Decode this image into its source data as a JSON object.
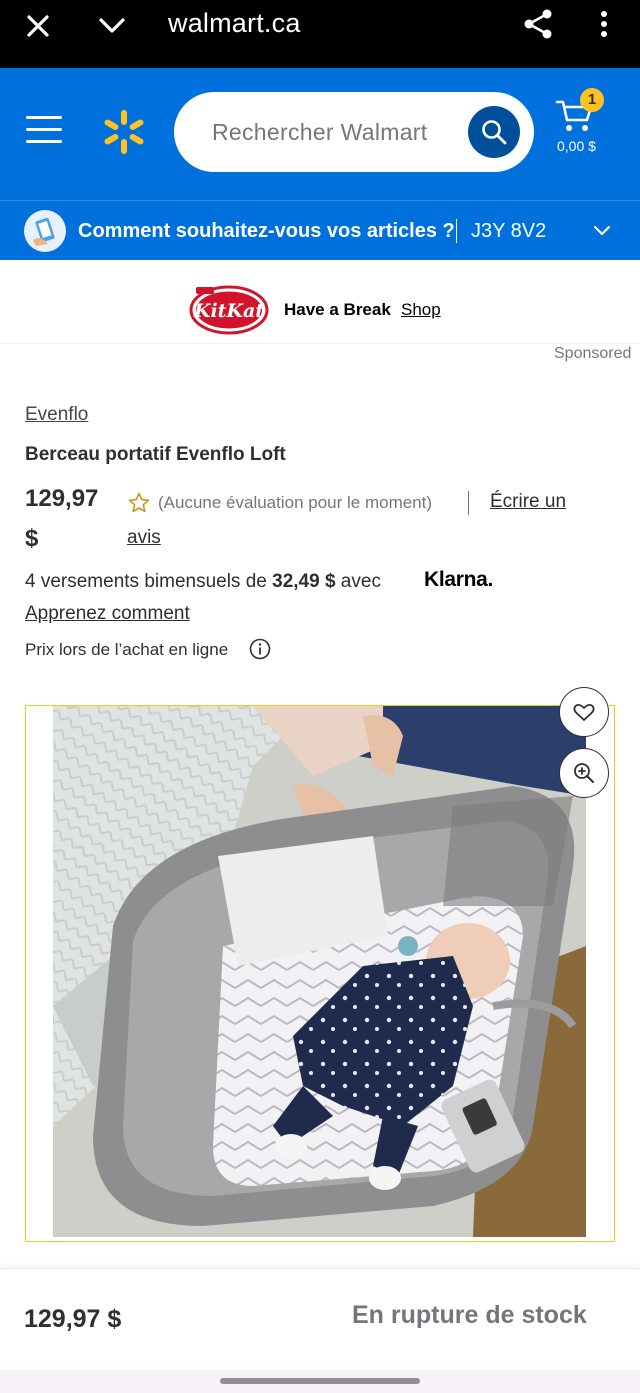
{
  "browser": {
    "url": "walmart.ca"
  },
  "header": {
    "search_placeholder": "Rechercher Walmart",
    "cart_count": "1",
    "cart_total": "0,00 $",
    "accent_color": "#0071dc",
    "spark_color": "#ffc220"
  },
  "fulfillment": {
    "prompt": "Comment souhaitez-vous vos articles ?",
    "postal_code": "J3Y 8V2"
  },
  "sponsor": {
    "brand_logo": "KitKat",
    "tagline": "Have a Break",
    "link": "Shop",
    "label": "Sponsored"
  },
  "product": {
    "brand": "Evenflo",
    "title": "Berceau portatif Evenflo Loft",
    "price_main": "129,97",
    "price_currency": "$",
    "rating_text": "(Aucune évaluation pour le moment)",
    "write_review_1": "Écrire un",
    "write_review_2": "avis",
    "installment_pre": "4 versements bimensuels de ",
    "installment_amount": "32,49 $",
    "installment_post": " avec",
    "klarna": "Klarna.",
    "learn_more": "Apprenez comment",
    "online_price": "Prix lors de l’achat en ligne"
  },
  "bottom_bar": {
    "price": "129,97 $",
    "status": "En rupture de stock"
  }
}
